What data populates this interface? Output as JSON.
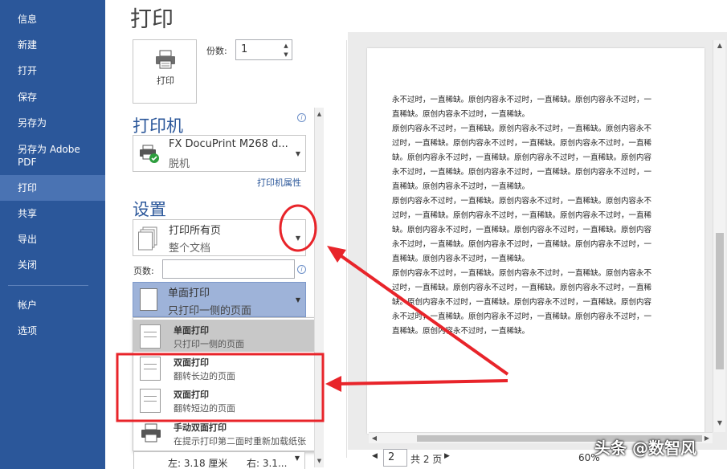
{
  "nav": {
    "items": [
      {
        "label": "信息"
      },
      {
        "label": "新建"
      },
      {
        "label": "打开"
      },
      {
        "label": "保存"
      },
      {
        "label": "另存为"
      },
      {
        "label": "另存为 Adobe PDF"
      },
      {
        "label": "打印"
      },
      {
        "label": "共享"
      },
      {
        "label": "导出"
      },
      {
        "label": "关闭"
      },
      {
        "label": "帐户"
      },
      {
        "label": "选项"
      }
    ],
    "active": "打印"
  },
  "print": {
    "title": "打印",
    "button_label": "打印",
    "copies_label": "份数:",
    "copies_value": "1",
    "printer_section": "打印机",
    "printer_name": "FX DocuPrint M268 d...",
    "printer_status": "脱机",
    "printer_properties": "打印机属性",
    "settings_section": "设置",
    "range_main": "打印所有页",
    "range_sub": "整个文档",
    "pages_label": "页数:",
    "pages_value": "",
    "sides_main": "单面打印",
    "sides_sub": "只打印一侧的页面",
    "menu": [
      {
        "title": "单面打印",
        "subtitle": "只打印一侧的页面"
      },
      {
        "title": "双面打印",
        "subtitle": "翻转长边的页面"
      },
      {
        "title": "双面打印",
        "subtitle": "翻转短边的页面"
      },
      {
        "title": "手动双面打印",
        "subtitle": "在提示打印第二面时重新加载纸张"
      }
    ],
    "margin_left": "左: 3.18 厘米",
    "margin_right": "右: 3.1..."
  },
  "preview": {
    "lines": [
      "永不过时，一直稀缺。原创内容永不过时，一直稀缺。原创内容永不过时，一",
      "直稀缺。原创内容永不过时，一直稀缺。",
      "原创内容永不过时，一直稀缺。原创内容永不过时，一直稀缺。原创内容永不",
      "过时，一直稀缺。原创内容永不过时，一直稀缺。原创内容永不过时，一直稀",
      "缺。原创内容永不过时，一直稀缺。原创内容永不过时，一直稀缺。原创内容",
      "永不过时，一直稀缺。原创内容永不过时，一直稀缺。原创内容永不过时，一",
      "直稀缺。原创内容永不过时，一直稀缺。",
      "原创内容永不过时，一直稀缺。原创内容永不过时，一直稀缺。原创内容永不",
      "过时，一直稀缺。原创内容永不过时，一直稀缺。原创内容永不过时，一直稀",
      "缺。原创内容永不过时，一直稀缺。原创内容永不过时，一直稀缺。原创内容",
      "永不过时，一直稀缺。原创内容永不过时，一直稀缺。原创内容永不过时，一",
      "直稀缺。原创内容永不过时，一直稀缺。",
      "原创内容永不过时，一直稀缺。原创内容永不过时，一直稀缺。原创内容永不",
      "过时，一直稀缺。原创内容永不过时，一直稀缺。原创内容永不过时，一直稀",
      "缺。原创内容永不过时，一直稀缺。原创内容永不过时，一直稀缺。原创内容",
      "永不过时，一直稀缺。原创内容永不过时，一直稀缺。原创内容永不过时，一",
      "直稀缺。原创内容永不过时，一直稀缺。"
    ],
    "current_page": "2",
    "total_pages": "共 2 页",
    "zoom": "60%"
  },
  "watermark": "头条 @数智风",
  "colors": {
    "nav_bg": "#2b579a",
    "accent": "#2b579a",
    "annotation_red": "#e8242a"
  }
}
